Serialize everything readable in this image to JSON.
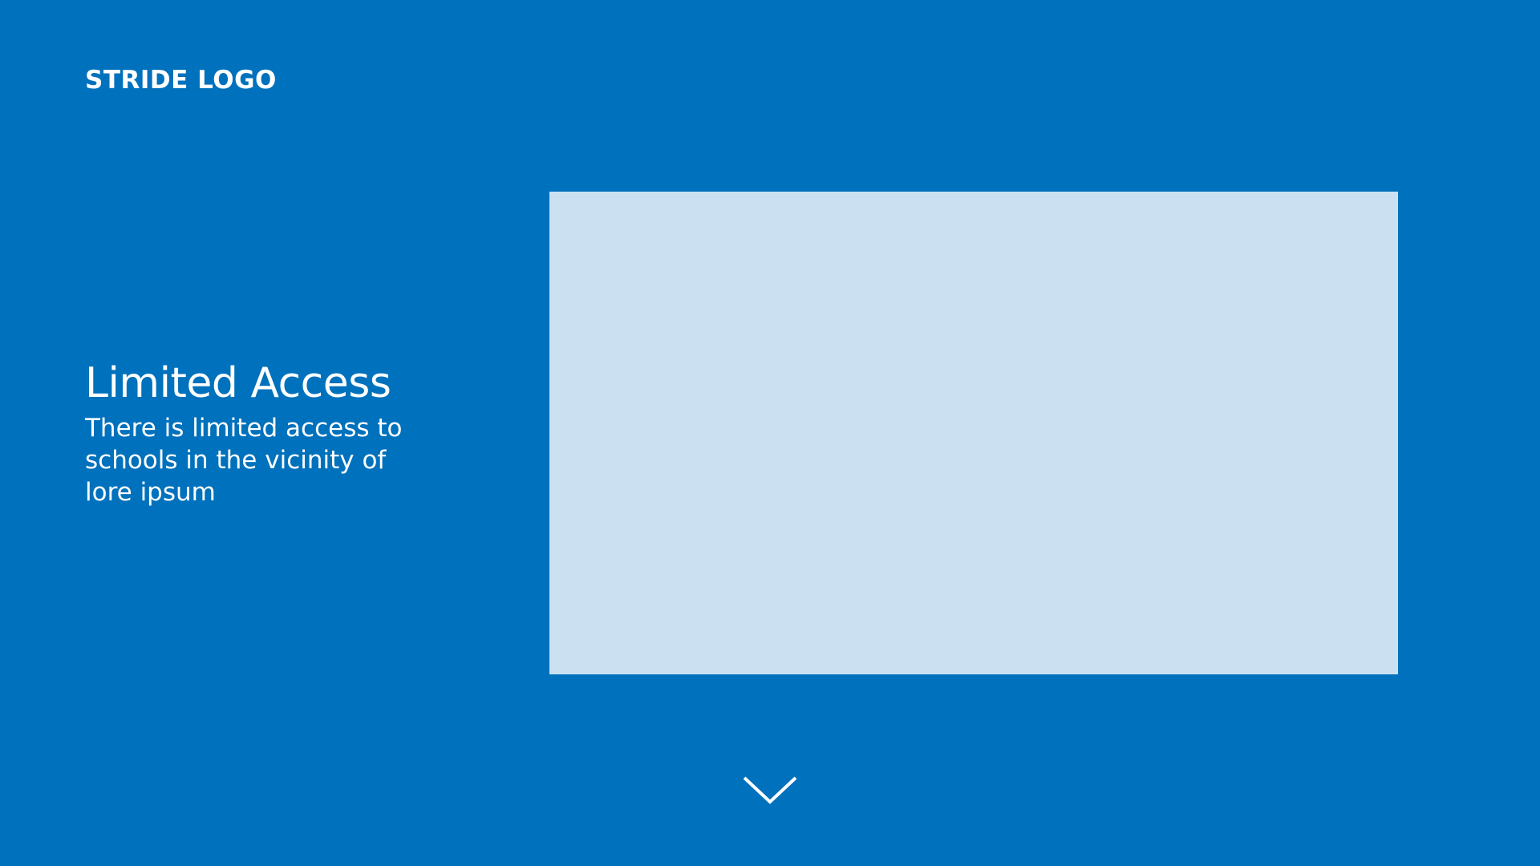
{
  "header": {
    "logo_text": "STRIDE LOGO"
  },
  "intro": {
    "title": "Limited Access",
    "description": "There is limited access to schools in the vicinity of lore ipsum"
  },
  "media": {
    "placeholder_color": "#CBE1F1"
  },
  "navigation": {
    "scroll_icon": "chevron-down-icon"
  },
  "colors": {
    "background": "#0071BC",
    "text": "#FFFFFF",
    "panel": "#CBE1F1"
  }
}
